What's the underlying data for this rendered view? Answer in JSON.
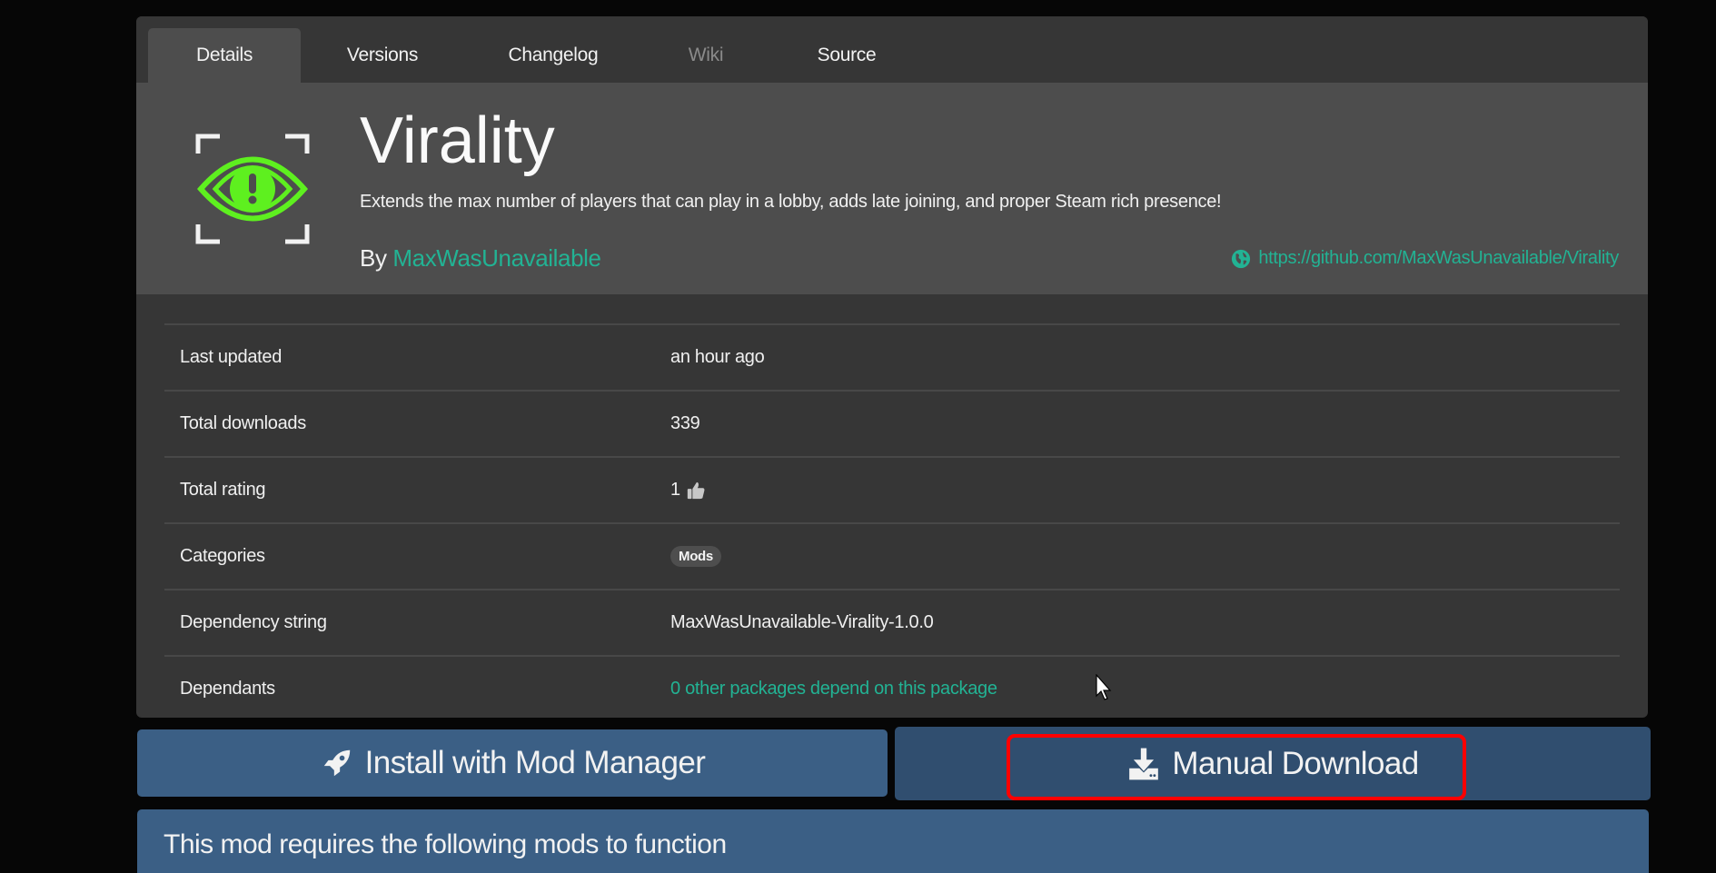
{
  "tabs": [
    {
      "label": "Details",
      "state": "active"
    },
    {
      "label": "Versions",
      "state": "normal"
    },
    {
      "label": "Changelog",
      "state": "normal"
    },
    {
      "label": "Wiki",
      "state": "disabled"
    },
    {
      "label": "Source",
      "state": "normal"
    }
  ],
  "package": {
    "icon": "virality-eye-logo",
    "name": "Virality",
    "description": "Extends the max number of players that can play in a lobby, adds late joining, and proper Steam rich presence!",
    "by_label": "By",
    "author": "MaxWasUnavailable",
    "website_icon": "globe-icon",
    "website": "https://github.com/MaxWasUnavailable/Virality"
  },
  "details": {
    "last_updated": {
      "label": "Last updated",
      "value": "an hour ago"
    },
    "total_downloads": {
      "label": "Total downloads",
      "value": "339"
    },
    "total_rating": {
      "label": "Total rating",
      "value": "1",
      "icon": "thumbs-up-icon"
    },
    "categories": {
      "label": "Categories",
      "values": [
        "Mods"
      ]
    },
    "dependency_string": {
      "label": "Dependency string",
      "value": "MaxWasUnavailable-Virality-1.0.0"
    },
    "dependants": {
      "label": "Dependants",
      "value": "0 other packages depend on this package"
    }
  },
  "actions": {
    "install": {
      "label": "Install with Mod Manager",
      "icon": "rocket-icon"
    },
    "manual": {
      "label": "Manual Download",
      "icon": "download-icon",
      "highlighted": true
    }
  },
  "requirements": {
    "title": "This mod requires the following mods to function"
  },
  "colors": {
    "accent": "#22b394",
    "button": "#3b5f85",
    "highlight": "#ff0000",
    "logo_green": "#5ef01f"
  }
}
